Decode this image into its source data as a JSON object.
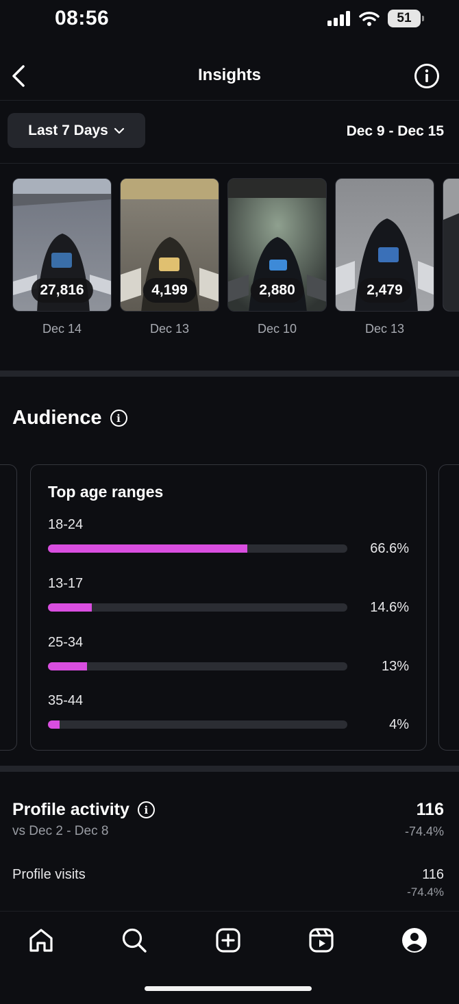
{
  "status_bar": {
    "time": "08:56",
    "battery": "51"
  },
  "header": {
    "title": "Insights"
  },
  "range": {
    "selector_label": "Last 7 Days",
    "dates": "Dec 9 - Dec 15"
  },
  "top_content": [
    {
      "count": "27,816",
      "date": "Dec 14"
    },
    {
      "count": "4,199",
      "date": "Dec 13"
    },
    {
      "count": "2,880",
      "date": "Dec 10"
    },
    {
      "count": "2,479",
      "date": "Dec 13"
    }
  ],
  "audience": {
    "title": "Audience",
    "card_title": "Top age ranges",
    "age_ranges": [
      {
        "label": "18-24",
        "percent_text": "66.6%",
        "fraction": 0.666
      },
      {
        "label": "13-17",
        "percent_text": "14.6%",
        "fraction": 0.146
      },
      {
        "label": "25-34",
        "percent_text": "13%",
        "fraction": 0.13
      },
      {
        "label": "35-44",
        "percent_text": "4%",
        "fraction": 0.04
      }
    ]
  },
  "profile_activity": {
    "title": "Profile activity",
    "comparison": "vs Dec 2 - Dec 8",
    "total": "116",
    "total_change": "-74.4%",
    "visits_label": "Profile visits",
    "visits_value": "116",
    "visits_change": "-74.4%"
  },
  "nav": [
    "home-icon",
    "search-icon",
    "create-icon",
    "reels-icon",
    "profile-icon"
  ],
  "colors": {
    "accent": "#d94ee0",
    "background": "#0d0e12"
  }
}
